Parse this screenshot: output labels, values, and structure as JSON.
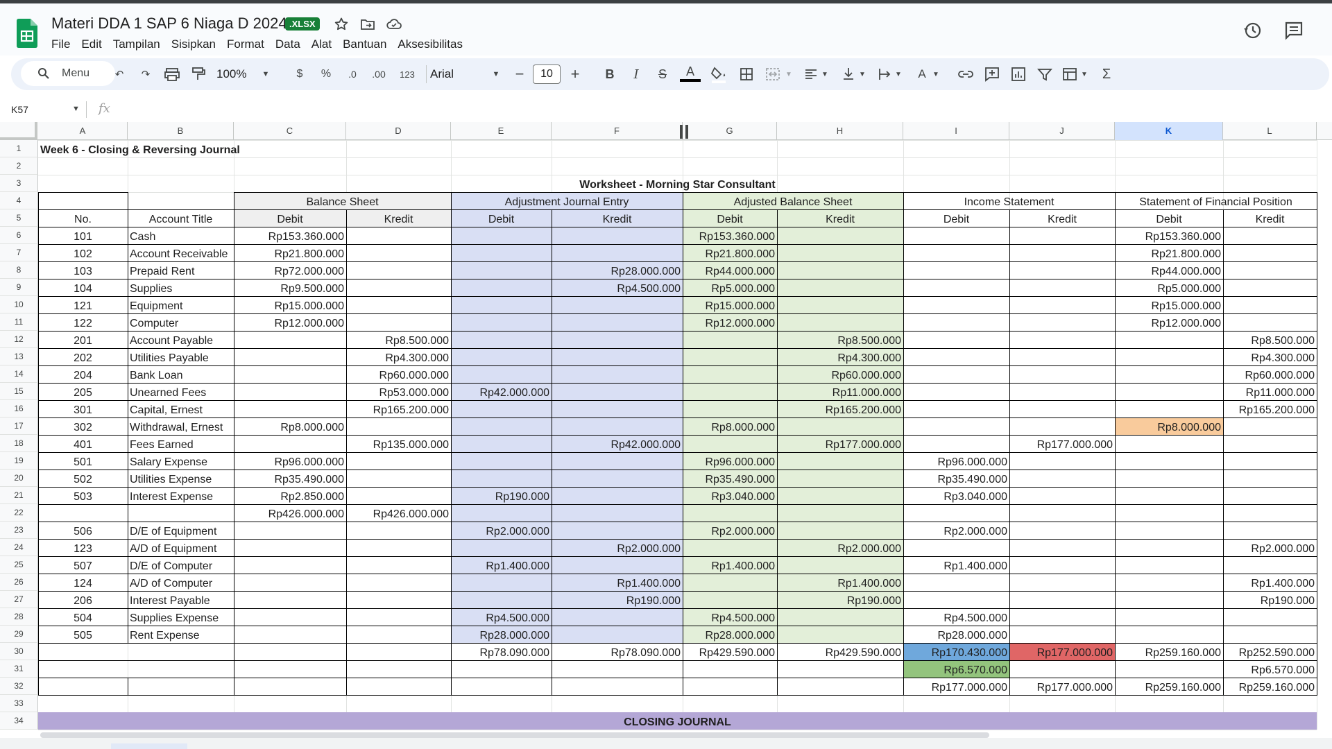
{
  "app": {
    "doc_title": "Materi DDA 1 SAP 6 Niaga D 2024",
    "file_badge": ".XLSX",
    "menu": [
      "File",
      "Edit",
      "Tampilan",
      "Sisipkan",
      "Format",
      "Data",
      "Alat",
      "Bantuan",
      "Aksesibilitas"
    ],
    "icons": {
      "star": "star-icon",
      "move": "folder-move-icon",
      "cloud": "cloud-status-icon",
      "history": "history-icon",
      "comments": "comments-icon"
    }
  },
  "toolbar": {
    "search_label": "Menu",
    "zoom": "100%",
    "currency": "$",
    "percent": "%",
    "dec_decrease": ".0",
    "dec_increase": ".00",
    "number_format": "123",
    "font": "Arial",
    "font_size": "10"
  },
  "formula_bar": {
    "name_box": "K57",
    "fx": "fx",
    "value": ""
  },
  "columns": [
    "A",
    "B",
    "C",
    "D",
    "E",
    "F",
    "G",
    "H",
    "I",
    "J",
    "K",
    "L"
  ],
  "selected_column": "K",
  "rows": [
    "1",
    "2",
    "3",
    "4",
    "5",
    "6",
    "7",
    "8",
    "9",
    "10",
    "11",
    "12",
    "13",
    "14",
    "15",
    "16",
    "17",
    "18",
    "19",
    "20",
    "21",
    "22",
    "23",
    "24",
    "25",
    "26",
    "27",
    "28",
    "29",
    "30",
    "31",
    "32",
    "33",
    "34"
  ],
  "sheet": {
    "title": "Week 6 - Closing & Reversing Journal",
    "worksheet_title": "Worksheet - Morning Star Consultant",
    "group_headers": [
      "Balance Sheet",
      "Adjustment Journal Entry",
      "Adjusted Balance Sheet",
      "Income Statement",
      "Statement of Financial Position"
    ],
    "col_headers": {
      "no": "No.",
      "title": "Account Title",
      "debit": "Debit",
      "kredit": "Kredit"
    },
    "closing_header": "CLOSING JOURNAL",
    "accounts": [
      {
        "no": "101",
        "title": "Cash",
        "c": "Rp153.360.000",
        "d": "",
        "e": "",
        "f": "",
        "g": "Rp153.360.000",
        "h": "",
        "i": "",
        "j": "",
        "k": "Rp153.360.000",
        "l": ""
      },
      {
        "no": "102",
        "title": "Account Receivable",
        "c": "Rp21.800.000",
        "d": "",
        "e": "",
        "f": "",
        "g": "Rp21.800.000",
        "h": "",
        "i": "",
        "j": "",
        "k": "Rp21.800.000",
        "l": ""
      },
      {
        "no": "103",
        "title": "Prepaid Rent",
        "c": "Rp72.000.000",
        "d": "",
        "e": "",
        "f": "Rp28.000.000",
        "g": "Rp44.000.000",
        "h": "",
        "i": "",
        "j": "",
        "k": "Rp44.000.000",
        "l": ""
      },
      {
        "no": "104",
        "title": "Supplies",
        "c": "Rp9.500.000",
        "d": "",
        "e": "",
        "f": "Rp4.500.000",
        "g": "Rp5.000.000",
        "h": "",
        "i": "",
        "j": "",
        "k": "Rp5.000.000",
        "l": ""
      },
      {
        "no": "121",
        "title": "Equipment",
        "c": "Rp15.000.000",
        "d": "",
        "e": "",
        "f": "",
        "g": "Rp15.000.000",
        "h": "",
        "i": "",
        "j": "",
        "k": "Rp15.000.000",
        "l": ""
      },
      {
        "no": "122",
        "title": "Computer",
        "c": "Rp12.000.000",
        "d": "",
        "e": "",
        "f": "",
        "g": "Rp12.000.000",
        "h": "",
        "i": "",
        "j": "",
        "k": "Rp12.000.000",
        "l": ""
      },
      {
        "no": "201",
        "title": "Account Payable",
        "c": "",
        "d": "Rp8.500.000",
        "e": "",
        "f": "",
        "g": "",
        "h": "Rp8.500.000",
        "i": "",
        "j": "",
        "k": "",
        "l": "Rp8.500.000"
      },
      {
        "no": "202",
        "title": "Utilities Payable",
        "c": "",
        "d": "Rp4.300.000",
        "e": "",
        "f": "",
        "g": "",
        "h": "Rp4.300.000",
        "i": "",
        "j": "",
        "k": "",
        "l": "Rp4.300.000"
      },
      {
        "no": "204",
        "title": "Bank Loan",
        "c": "",
        "d": "Rp60.000.000",
        "e": "",
        "f": "",
        "g": "",
        "h": "Rp60.000.000",
        "i": "",
        "j": "",
        "k": "",
        "l": "Rp60.000.000"
      },
      {
        "no": "205",
        "title": "Unearned Fees",
        "c": "",
        "d": "Rp53.000.000",
        "e": "Rp42.000.000",
        "f": "",
        "g": "",
        "h": "Rp11.000.000",
        "i": "",
        "j": "",
        "k": "",
        "l": "Rp11.000.000"
      },
      {
        "no": "301",
        "title": "Capital, Ernest",
        "c": "",
        "d": "Rp165.200.000",
        "e": "",
        "f": "",
        "g": "",
        "h": "Rp165.200.000",
        "i": "",
        "j": "",
        "k": "",
        "l": "Rp165.200.000"
      },
      {
        "no": "302",
        "title": "Withdrawal, Ernest",
        "c": "Rp8.000.000",
        "d": "",
        "e": "",
        "f": "",
        "g": "Rp8.000.000",
        "h": "",
        "i": "",
        "j": "",
        "k": "Rp8.000.000",
        "l": ""
      },
      {
        "no": "401",
        "title": "Fees Earned",
        "c": "",
        "d": "Rp135.000.000",
        "e": "",
        "f": "Rp42.000.000",
        "g": "",
        "h": "Rp177.000.000",
        "i": "",
        "j": "Rp177.000.000",
        "k": "",
        "l": ""
      },
      {
        "no": "501",
        "title": "Salary Expense",
        "c": "Rp96.000.000",
        "d": "",
        "e": "",
        "f": "",
        "g": "Rp96.000.000",
        "h": "",
        "i": "Rp96.000.000",
        "j": "",
        "k": "",
        "l": ""
      },
      {
        "no": "502",
        "title": "Utilities Expense",
        "c": "Rp35.490.000",
        "d": "",
        "e": "",
        "f": "",
        "g": "Rp35.490.000",
        "h": "",
        "i": "Rp35.490.000",
        "j": "",
        "k": "",
        "l": ""
      },
      {
        "no": "503",
        "title": "Interest Expense",
        "c": "Rp2.850.000",
        "d": "",
        "e": "Rp190.000",
        "f": "",
        "g": "Rp3.040.000",
        "h": "",
        "i": "Rp3.040.000",
        "j": "",
        "k": "",
        "l": ""
      },
      {
        "no": "",
        "title": "",
        "c": "Rp426.000.000",
        "d": "Rp426.000.000",
        "e": "",
        "f": "",
        "g": "",
        "h": "",
        "i": "",
        "j": "",
        "k": "",
        "l": ""
      },
      {
        "no": "506",
        "title": "D/E of Equipment",
        "c": "",
        "d": "",
        "e": "Rp2.000.000",
        "f": "",
        "g": "Rp2.000.000",
        "h": "",
        "i": "Rp2.000.000",
        "j": "",
        "k": "",
        "l": ""
      },
      {
        "no": "123",
        "title": "A/D of Equipment",
        "c": "",
        "d": "",
        "e": "",
        "f": "Rp2.000.000",
        "g": "",
        "h": "Rp2.000.000",
        "i": "",
        "j": "",
        "k": "",
        "l": "Rp2.000.000"
      },
      {
        "no": "507",
        "title": "D/E of Computer",
        "c": "",
        "d": "",
        "e": "Rp1.400.000",
        "f": "",
        "g": "Rp1.400.000",
        "h": "",
        "i": "Rp1.400.000",
        "j": "",
        "k": "",
        "l": ""
      },
      {
        "no": "124",
        "title": "A/D of Computer",
        "c": "",
        "d": "",
        "e": "",
        "f": "Rp1.400.000",
        "g": "",
        "h": "Rp1.400.000",
        "i": "",
        "j": "",
        "k": "",
        "l": "Rp1.400.000"
      },
      {
        "no": "206",
        "title": "Interest Payable",
        "c": "",
        "d": "",
        "e": "",
        "f": "Rp190.000",
        "g": "",
        "h": "Rp190.000",
        "i": "",
        "j": "",
        "k": "",
        "l": "Rp190.000"
      },
      {
        "no": "504",
        "title": "Supplies Expense",
        "c": "",
        "d": "",
        "e": "Rp4.500.000",
        "f": "",
        "g": "Rp4.500.000",
        "h": "",
        "i": "Rp4.500.000",
        "j": "",
        "k": "",
        "l": ""
      },
      {
        "no": "505",
        "title": "Rent Expense",
        "c": "",
        "d": "",
        "e": "Rp28.000.000",
        "f": "",
        "g": "Rp28.000.000",
        "h": "",
        "i": "Rp28.000.000",
        "j": "",
        "k": "",
        "l": ""
      }
    ],
    "totals": {
      "e": "Rp78.090.000",
      "f": "Rp78.090.000",
      "g": "Rp429.590.000",
      "h": "Rp429.590.000",
      "i": "Rp170.430.000",
      "j": "Rp177.000.000",
      "k": "Rp259.160.000",
      "l": "Rp252.590.000"
    },
    "net": {
      "i": "Rp6.570.000",
      "l": "Rp6.570.000"
    },
    "final": {
      "i": "Rp177.000.000",
      "j": "Rp177.000.000",
      "k": "Rp259.160.000",
      "l": "Rp259.160.000"
    },
    "colors": {
      "balance_header_fill": "#efefef",
      "adjustment_fill": "#d9dff4",
      "adjusted_fill": "#e3efd9",
      "withdrawal_fill": "#f9cb9c",
      "total_income_fill": "#6fa8dc",
      "total_revenue_fill": "#e06666",
      "net_income_fill": "#93c47d",
      "closing_bar": "#b4a7d6"
    }
  }
}
